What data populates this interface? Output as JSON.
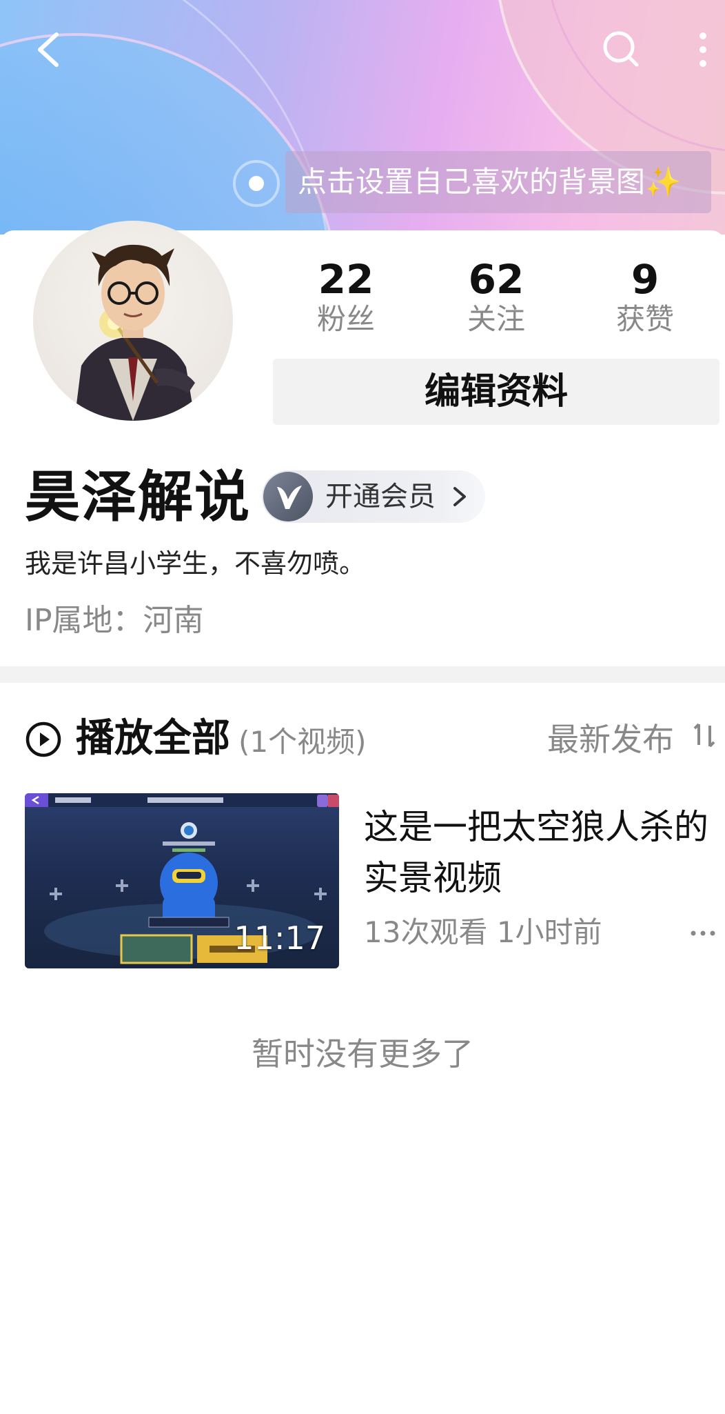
{
  "header": {
    "background_hint": "点击设置自己喜欢的背景图✨"
  },
  "profile": {
    "stats": [
      {
        "value": "22",
        "label": "粉丝"
      },
      {
        "value": "62",
        "label": "关注"
      },
      {
        "value": "9",
        "label": "获赞"
      }
    ],
    "edit_button_label": "编辑资料",
    "name": "昊泽解说",
    "vip_label": "开通会员",
    "bio": "我是许昌小学生，不喜勿喷。",
    "ip_location": "IP属地：河南"
  },
  "videos_section": {
    "play_all_label": "播放全部",
    "video_count": "(1个视频)",
    "sort_label": "最新发布"
  },
  "videos": [
    {
      "title": "这是一把太空狼人杀的实景视频",
      "duration": "11:17",
      "views": "13次观看",
      "time_ago": "1小时前"
    }
  ],
  "footer": {
    "no_more_text": "暂时没有更多了"
  },
  "colors": {
    "text_primary": "#111111",
    "text_secondary": "#888888",
    "button_bg": "#f2f2f2",
    "divider": "#f2f2f2"
  }
}
